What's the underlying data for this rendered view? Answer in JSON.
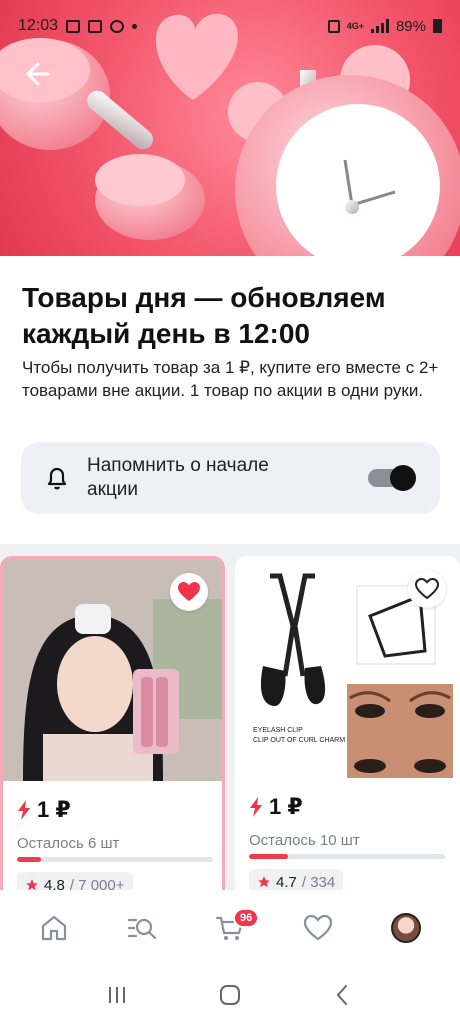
{
  "status_bar": {
    "time": "12:03",
    "network": "4G+",
    "battery": "89%"
  },
  "hero": {
    "back_icon": "back-arrow-icon",
    "colors": {
      "background": "#f3566b"
    }
  },
  "header": {
    "title": "Товары дня — обновляем каждый день в 12:00",
    "subtitle": "Чтобы получить товар за 1 ₽, купите его вместе с 2+ товарами вне акции. 1 товар по акции в одни руки."
  },
  "reminder": {
    "label": "Напомнить о начале акции",
    "toggle_on": true
  },
  "products": [
    {
      "price": "1 ₽",
      "remaining": "Осталось 6 шт",
      "progress": 0.12,
      "rating": "4.8",
      "reviews": "/ 7 000+",
      "favorited": true,
      "image_text": []
    },
    {
      "price": "1 ₽",
      "remaining": "Осталось 10 шт",
      "progress": 0.2,
      "rating": "4.7",
      "reviews": "/ 334",
      "favorited": false,
      "image_text": [
        "EYELASH CLIP",
        "CLIP OUT OF CURL CHARM"
      ]
    }
  ],
  "bottom_nav": {
    "items": [
      "home-icon",
      "catalog-search-icon",
      "cart-icon",
      "favorites-icon",
      "profile-avatar"
    ],
    "cart_badge": "96"
  },
  "colors": {
    "accent": "#f0344b",
    "card_bg": "#eef0f6"
  }
}
